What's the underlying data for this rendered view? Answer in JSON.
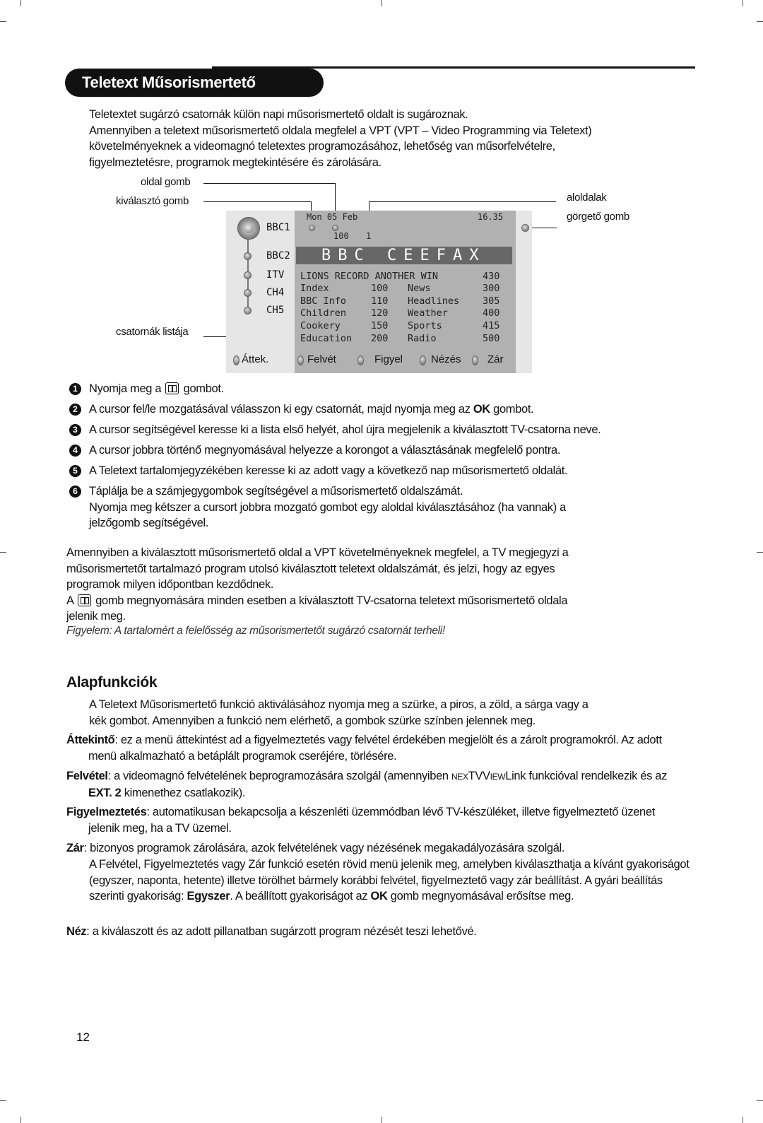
{
  "page": {
    "title": "Teletext Műsorismertető",
    "intro": [
      "Teletextet sugárzó csatornák külön napi műsorismertető oldalt is sugároznak.",
      "Amennyiben a teletext műsorismertető oldala megfelel a VPT (VPT – Video Programming via Teletext)",
      "követelményeknek a videomagnó teletextes programozásához, lehetőség van műsorfelvételre,",
      "figyelmeztetésre, programok megtekintésére és zárolására."
    ],
    "page_number": "12"
  },
  "diagram": {
    "callouts": {
      "page_button": "oldal gomb",
      "select_button": "kiválasztó gomb",
      "channel_list": "csatornák listája",
      "subpages": "aloldalak",
      "scroll_button": "görgető gomb"
    },
    "channels": [
      "BBC1",
      "BBC2",
      "ITV",
      "CH4",
      "CH5"
    ],
    "header": {
      "date": "Mon 05 Feb",
      "time": "16.35",
      "page": "100",
      "subpage": "1"
    },
    "banner": "BBC CEEFAX",
    "headline": {
      "text": "LIONS RECORD ANOTHER WIN",
      "page": "430"
    },
    "index_rows": [
      {
        "left_label": "Index",
        "left_page": "100",
        "right_label": "News",
        "right_page": "300"
      },
      {
        "left_label": "BBC Info",
        "left_page": "110",
        "right_label": "Headlines",
        "right_page": "305"
      },
      {
        "left_label": "Children",
        "left_page": "120",
        "right_label": "Weather",
        "right_page": "400"
      },
      {
        "left_label": "Cookery",
        "left_page": "150",
        "right_label": "Sports",
        "right_page": "415"
      },
      {
        "left_label": "Education",
        "left_page": "200",
        "right_label": "Radio",
        "right_page": "500"
      }
    ],
    "buttons": [
      "Áttek.",
      "Felvét",
      "Figyel",
      "Nézés",
      "Zár"
    ]
  },
  "steps": [
    {
      "num": "1",
      "pre": "Nyomja meg a",
      "post": "gombot."
    },
    {
      "num": "2",
      "pre": "A cursor fel/le mozgatásával válasszon ki egy csatornát, majd nyomja meg az",
      "bold": "OK",
      "post": "gombot."
    },
    {
      "num": "3",
      "text": "A cursor segítségével keresse ki a lista első helyét, ahol újra megjelenik a kiválasztott TV-csatorna neve."
    },
    {
      "num": "4",
      "text": "A cursor jobbra történő megnyomásával helyezze a korongot a választásának megfelelő pontra."
    },
    {
      "num": "5",
      "text": "A Teletext tartalomjegyzékében keresse ki az adott vagy a következő nap műsorismertető oldalát."
    },
    {
      "num": "6",
      "lines": [
        "Táplálja be a számjegygombok segítségével a műsorismertető oldalszámát.",
        "Nyomja meg kétszer a cursort jobbra mozgató gombot egy aloldal kiválasztásához (ha vannak) a",
        "jelzőgomb segítségével."
      ]
    }
  ],
  "vpt_paragraph": [
    "Amennyiben a kiválasztott műsorismertető oldal a VPT követelményeknek megfelel, a TV megjegyzi a",
    "műsorismertetőt tartalmazó program utolsó kiválasztott teletext oldalszámát, és jelzi, hogy az egyes",
    "programok  milyen időpontban kezdődnek."
  ],
  "guide_button_paragraph": {
    "pre": "A",
    "post": "gomb megnyomására minden esetben a kiválasztott TV-csatorna teletext műsorismertető oldala",
    "line2": "jelenik meg."
  },
  "warning": "Figyelem: A tartalomért a felelősség az  műsorismertetőt sugárzó csatornát terheli!",
  "basic": {
    "heading": "Alapfunkciók",
    "intro": [
      "A Teletext Műsorismertető funkció aktiválásához nyomja meg a szürke, a piros, a zöld, a sárga vagy a",
      "kék gombot. Amennyiben a funkció nem elérhető, a gombok szürke színben jelennek meg."
    ],
    "defs": [
      {
        "term": "Áttekintő",
        "text": ": ez a menü áttekintést ad a figyelmeztetés vagy felvétel érdekében megjelölt és a zárolt programokról.  Az adott menü alkalmazható a betáplált programok cseréjére, törlésére."
      },
      {
        "term": "Felvétel",
        "text_a": ": a videomagnó felvételének beprogramozására szolgál (amennyiben ",
        "brand_a": "NEX",
        "brand_b": "TV",
        "brand_c": "IEW",
        "brand_v": "V",
        "text_b": "Link funkcióval rendelkezik és az ",
        "bold": "EXT. 2",
        "text_c": " kimenethez csatlakozik)."
      },
      {
        "term": "Figyelmeztetés",
        "text": ": automatikusan bekapcsolja a készenléti üzemmódban lévő TV-készüléket, illetve figyelmeztető üzenet jelenik meg, ha a TV üzemel."
      },
      {
        "term": "Zár",
        "text": ": bizonyos programok zárolására, azok felvételének vagy nézésének megakadályozására szolgál.",
        "cont_a": "A Felvétel, Figyelmeztetés vagy Zár funkció esetén rövid menü jelenik meg, amelyben kiválaszthatja a kívánt gyakoriságot (egyszer, naponta, hetente) illetve törölhet bármely korábbi felvétel, figyelmeztető vagy zár beállítást. A gyári beállítás szerinti gyakoriság: ",
        "bold1": "Egyszer",
        "cont_b": ". A beállított gyakoriságot az ",
        "bold2": "OK",
        "cont_c": " gomb megnyomásával erősítse meg."
      },
      {
        "term": "Néz",
        "text": ": a kiválaszott és az adott pillanatban sugárzott program nézését teszi lehetővé."
      }
    ]
  }
}
